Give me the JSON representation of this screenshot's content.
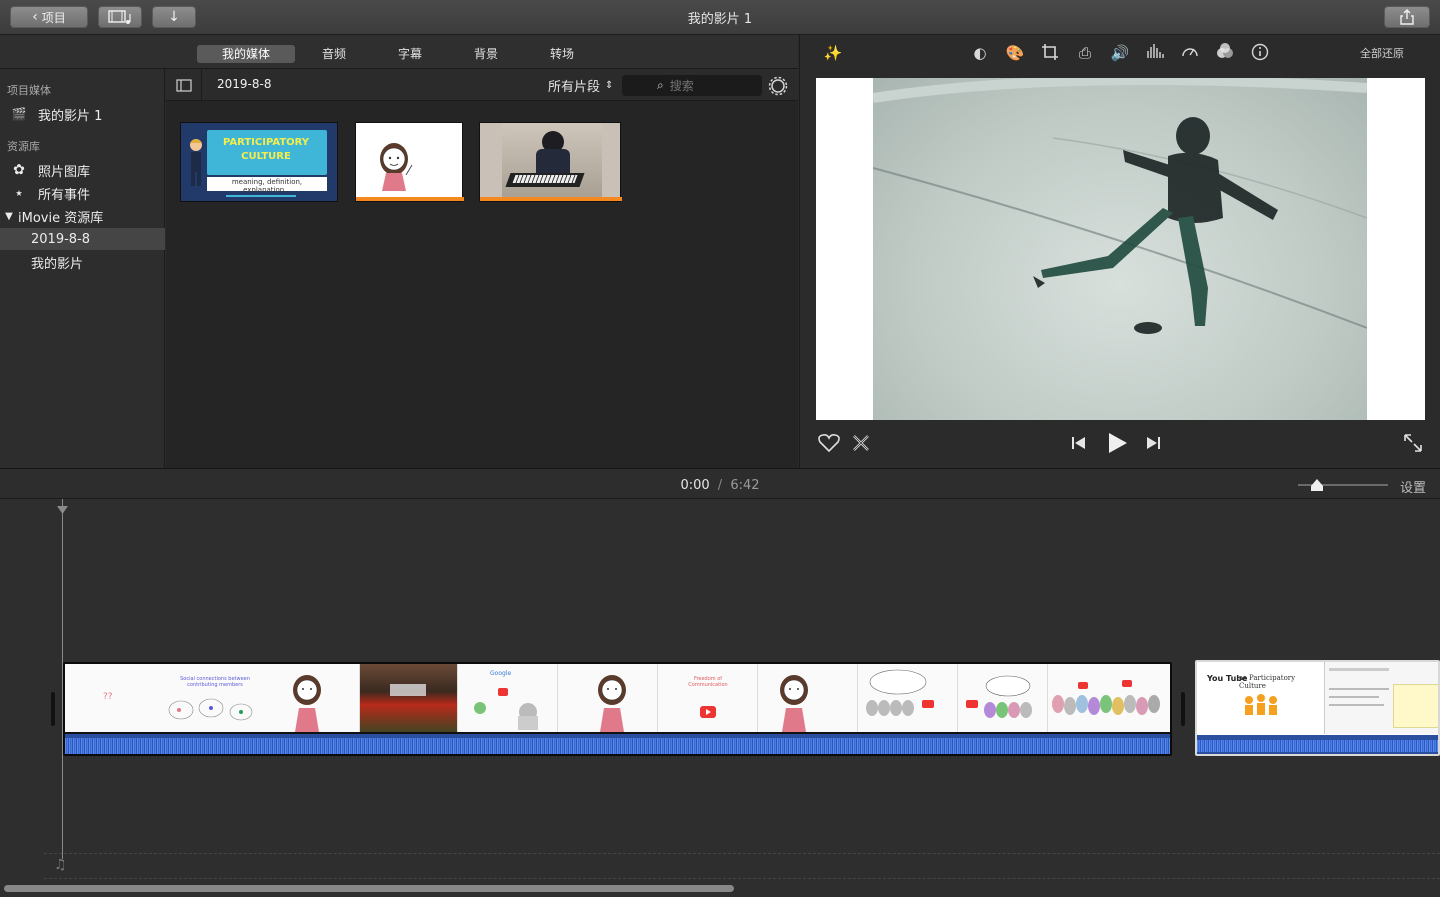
{
  "toolbar": {
    "back_label": "项目",
    "window_title": "我的影片 1"
  },
  "browser_tabs": [
    {
      "label": "我的媒体",
      "active": true
    },
    {
      "label": "音频",
      "active": false
    },
    {
      "label": "字幕",
      "active": false
    },
    {
      "label": "背景",
      "active": false
    },
    {
      "label": "转场",
      "active": false
    }
  ],
  "sidebar": {
    "project_section": "项目媒体",
    "project_item": "我的影片 1",
    "library_section": "资源库",
    "photos_item": "照片图库",
    "all_events_item": "所有事件",
    "imovie_library": "iMovie 资源库",
    "event_1": "2019-8-8",
    "event_2": "我的影片"
  },
  "browser": {
    "event_title": "2019-8-8",
    "filter_label": "所有片段",
    "search_placeholder": "搜索",
    "clip1_title": "PARTICIPATORY CULTURE",
    "clip1_subtitle": "meaning, definition, explanation..."
  },
  "viewer": {
    "reset_all": "全部还原"
  },
  "timeline": {
    "current_time": "0:00",
    "separator": "/",
    "total_time": "6:42",
    "settings_label": "设置",
    "clip_text_social": "Social connections between contributing members",
    "clip_text_google": "Google",
    "clip_text_freedom": "Freedom of Communication",
    "clip_text_youtube_title": "as Participatory Culture",
    "clip_text_youtube_logo": "You Tube"
  },
  "colors": {
    "accent_blue": "#3d5ab8",
    "audio_wave": "#3a68d4",
    "orange_bar": "#f5881f"
  }
}
